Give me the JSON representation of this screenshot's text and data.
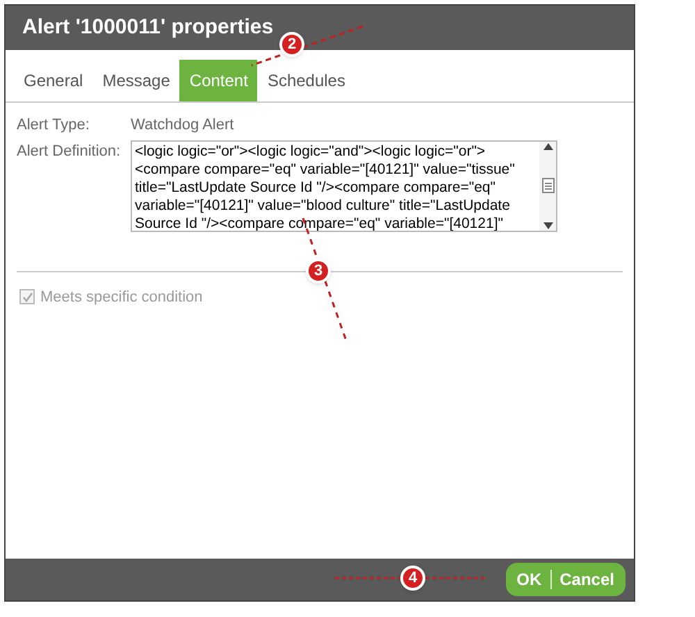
{
  "window": {
    "title": "Alert '1000011' properties"
  },
  "tabs": [
    {
      "label": "General",
      "selected": false
    },
    {
      "label": "Message",
      "selected": false
    },
    {
      "label": "Content",
      "selected": true
    },
    {
      "label": "Schedules",
      "selected": false
    }
  ],
  "fields": [
    {
      "label": "Alert Type:",
      "value": "Watchdog Alert"
    },
    {
      "label": "Alert Definition:",
      "value": "<logic logic=\"or\"><logic logic=\"and\"><logic logic=\"or\"> <compare compare=\"eq\" variable=\"[40121]\" value=\"tissue\" title=\"LastUpdate Source Id \"/><compare compare=\"eq\" variable=\"[40121]\" value=\"blood culture\" title=\"LastUpdate Source Id \"/><compare compare=\"eq\" variable=\"[40121]\""
    }
  ],
  "condition": {
    "label": "Meets specific condition",
    "checked": true,
    "disabled": true
  },
  "buttons": [
    "OK",
    "Cancel"
  ],
  "callouts": [
    "2",
    "3",
    "4"
  ]
}
